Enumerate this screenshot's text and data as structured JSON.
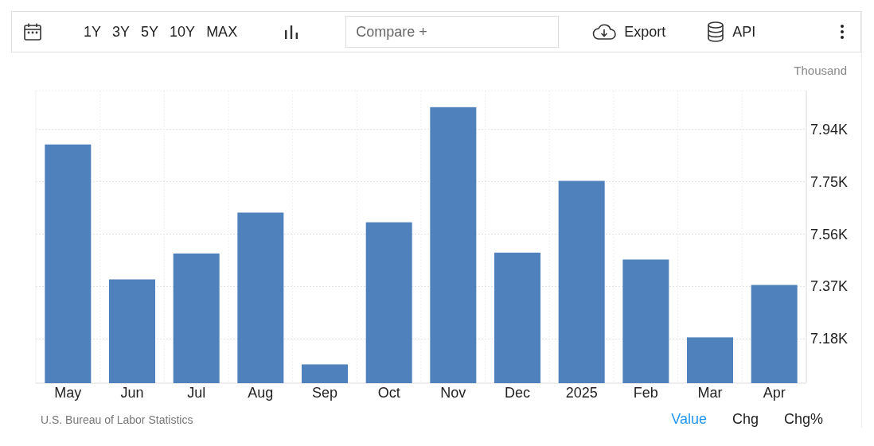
{
  "toolbar": {
    "ranges": [
      {
        "label": "1Y",
        "selected": false
      },
      {
        "label": "3Y",
        "selected": false
      },
      {
        "label": "5Y",
        "selected": false
      },
      {
        "label": "10Y",
        "selected": false
      },
      {
        "label": "MAX",
        "selected": false
      }
    ],
    "compare": {
      "placeholder": "Compare +"
    },
    "export": "Export",
    "api": "API"
  },
  "chart": {
    "unit": "Thousand",
    "chart_data": {
      "type": "bar",
      "categories": [
        "May",
        "Jun",
        "Jul",
        "Aug",
        "Sep",
        "Oct",
        "Nov",
        "Dec",
        "2025",
        "Feb",
        "Mar",
        "Apr"
      ],
      "grid": true,
      "series": [
        {
          "color": "#4f81bd",
          "values": [
            7.885,
            7.396,
            7.49,
            7.638,
            7.088,
            7.603,
            8.02,
            7.493,
            7.753,
            7.468,
            7.186,
            7.376
          ]
        }
      ],
      "ylim": [
        7.02,
        8.08
      ],
      "yticks": [
        {
          "value": 7.18,
          "label": "7.18K"
        },
        {
          "value": 7.37,
          "label": "7.37K"
        },
        {
          "value": 7.56,
          "label": "7.56K"
        },
        {
          "value": 7.75,
          "label": "7.75K"
        },
        {
          "value": 7.94,
          "label": "7.94K"
        }
      ]
    }
  },
  "footer": {
    "source": "U.S. Bureau of Labor Statistics",
    "views": [
      {
        "label": "Value",
        "selected": true
      },
      {
        "label": "Chg",
        "selected": false
      },
      {
        "label": "Chg%",
        "selected": false
      }
    ]
  }
}
